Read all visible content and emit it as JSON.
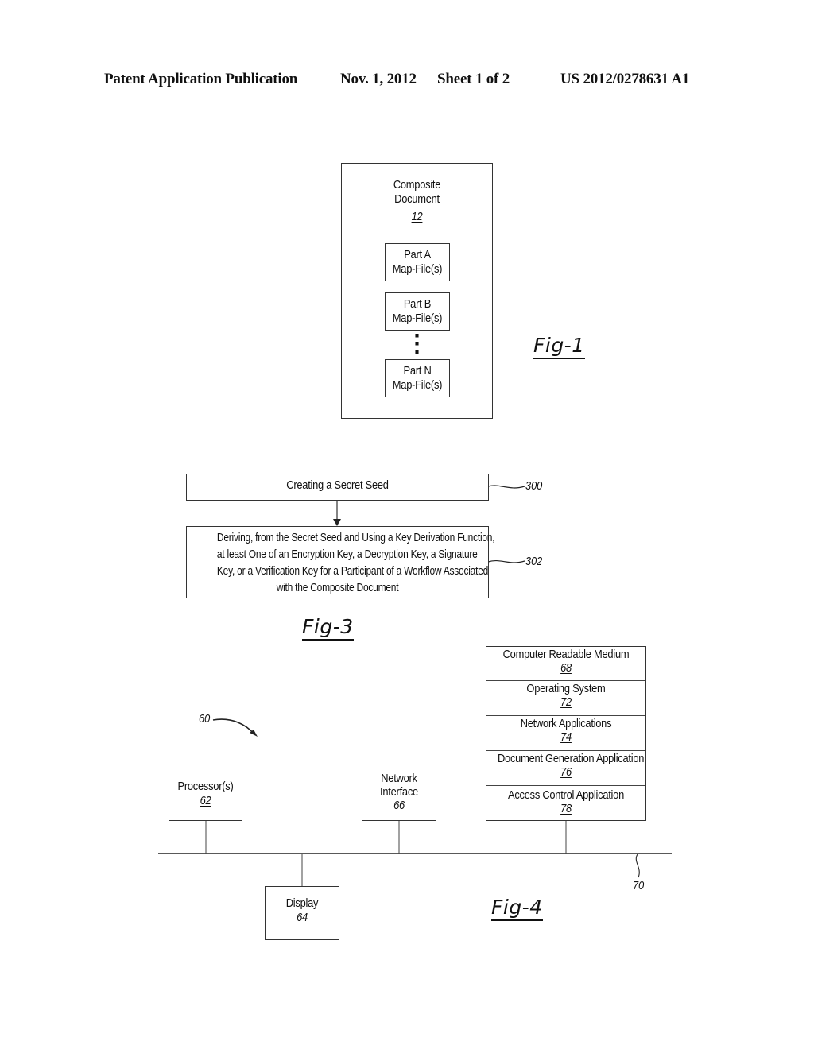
{
  "header": {
    "publication": "Patent Application Publication",
    "date": "Nov. 1, 2012",
    "sheet": "Sheet 1 of 2",
    "number": "US 2012/0278631 A1"
  },
  "fig1": {
    "title": "Fig-1",
    "container_label_line1": "Composite",
    "container_label_line2": "Document",
    "container_ref": "12",
    "parts": [
      {
        "line1": "Part A",
        "line2": "Map-File(s)"
      },
      {
        "line1": "Part B",
        "line2": "Map-File(s)"
      },
      {
        "line1": "Part N",
        "line2": "Map-File(s)"
      }
    ],
    "ellipsis": "⋮"
  },
  "fig3": {
    "title": "Fig-3",
    "steps": [
      {
        "text": "Creating a Secret Seed",
        "ref": "300"
      },
      {
        "line1": "Deriving, from the Secret Seed and Using a Key Derivation Function,",
        "line2": "at least One of an Encryption Key, a Decryption Key, a Signature",
        "line3": "Key, or a Verification Key for a Participant of a Workflow Associated",
        "line4": "with the Composite Document",
        "ref": "302"
      }
    ]
  },
  "fig4": {
    "title": "Fig-4",
    "system_ref": "60",
    "bus_ref": "70",
    "processor": {
      "label": "Processor(s)",
      "ref": "62"
    },
    "display": {
      "label": "Display",
      "ref": "64"
    },
    "network": {
      "line1": "Network",
      "line2": "Interface",
      "ref": "66"
    },
    "medium_stack": [
      {
        "label": "Computer Readable Medium",
        "ref": "68"
      },
      {
        "label": "Operating System",
        "ref": "72"
      },
      {
        "label": "Network Applications",
        "ref": "74"
      },
      {
        "label": "Document Generation Application",
        "ref": "76"
      },
      {
        "label": "Access Control Application",
        "ref": "78"
      }
    ]
  }
}
